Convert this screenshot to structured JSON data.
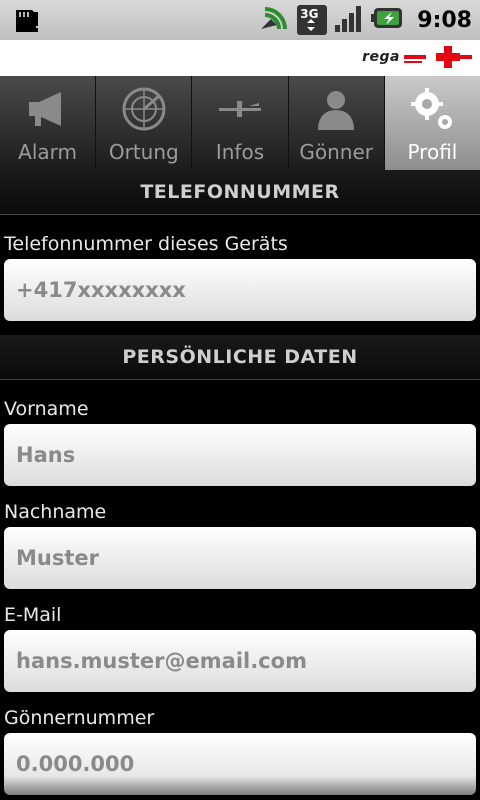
{
  "status": {
    "time": "9:08",
    "network": "3G"
  },
  "brand": {
    "text": "rega"
  },
  "tabs": [
    {
      "label": "Alarm",
      "icon": "megaphone-icon"
    },
    {
      "label": "Ortung",
      "icon": "radar-icon"
    },
    {
      "label": "Infos",
      "icon": "aircraft-icon"
    },
    {
      "label": "Gönner",
      "icon": "person-icon"
    },
    {
      "label": "Profil",
      "icon": "gear-icon"
    }
  ],
  "sections": {
    "phone": {
      "header": "TELEFONNUMMER",
      "label": "Telefonnummer dieses Geräts",
      "value": "+417xxxxxxxx"
    },
    "personal": {
      "header": "PERSÖNLICHE DATEN",
      "firstname_label": "Vorname",
      "firstname_value": "Hans",
      "lastname_label": "Nachname",
      "lastname_value": "Muster",
      "email_label": "E-Mail",
      "email_value": "hans.muster@email.com",
      "member_label": "Gönnernummer",
      "member_value": "0.000.000"
    }
  },
  "colors": {
    "accent": "#e30613",
    "active_tab": "#b0b0b0"
  }
}
